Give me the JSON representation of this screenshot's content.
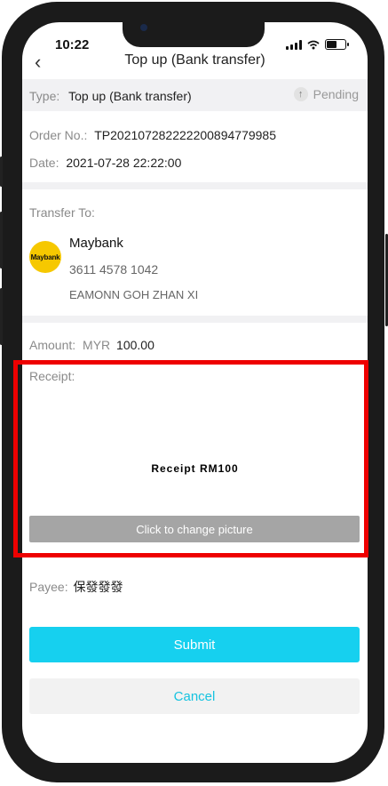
{
  "status_bar": {
    "time": "10:22"
  },
  "nav": {
    "title": "Top up (Bank transfer)"
  },
  "type_row": {
    "label": "Type:",
    "value": "Top up (Bank transfer)",
    "status": "Pending"
  },
  "order": {
    "order_label": "Order No.:",
    "order_value": "TP202107282222200894779985",
    "date_label": "Date:",
    "date_value": "2021-07-28 22:22:00"
  },
  "transfer": {
    "label": "Transfer To:",
    "bank_name": "Maybank",
    "bank_logo_text": "Maybank",
    "account_number": "3611 4578 1042",
    "account_holder": "EAMONN GOH ZHAN XI"
  },
  "amount": {
    "label": "Amount:",
    "currency": "MYR",
    "value": "100.00"
  },
  "receipt": {
    "label": "Receipt:",
    "image_text": "Receipt RM100",
    "change_button": "Click to change picture"
  },
  "payee": {
    "label": "Payee:",
    "value": "保發發發"
  },
  "actions": {
    "submit": "Submit",
    "cancel": "Cancel"
  },
  "colors": {
    "accent": "#16d0ef",
    "highlight": "#ee0000",
    "logo": "#f6c800"
  }
}
